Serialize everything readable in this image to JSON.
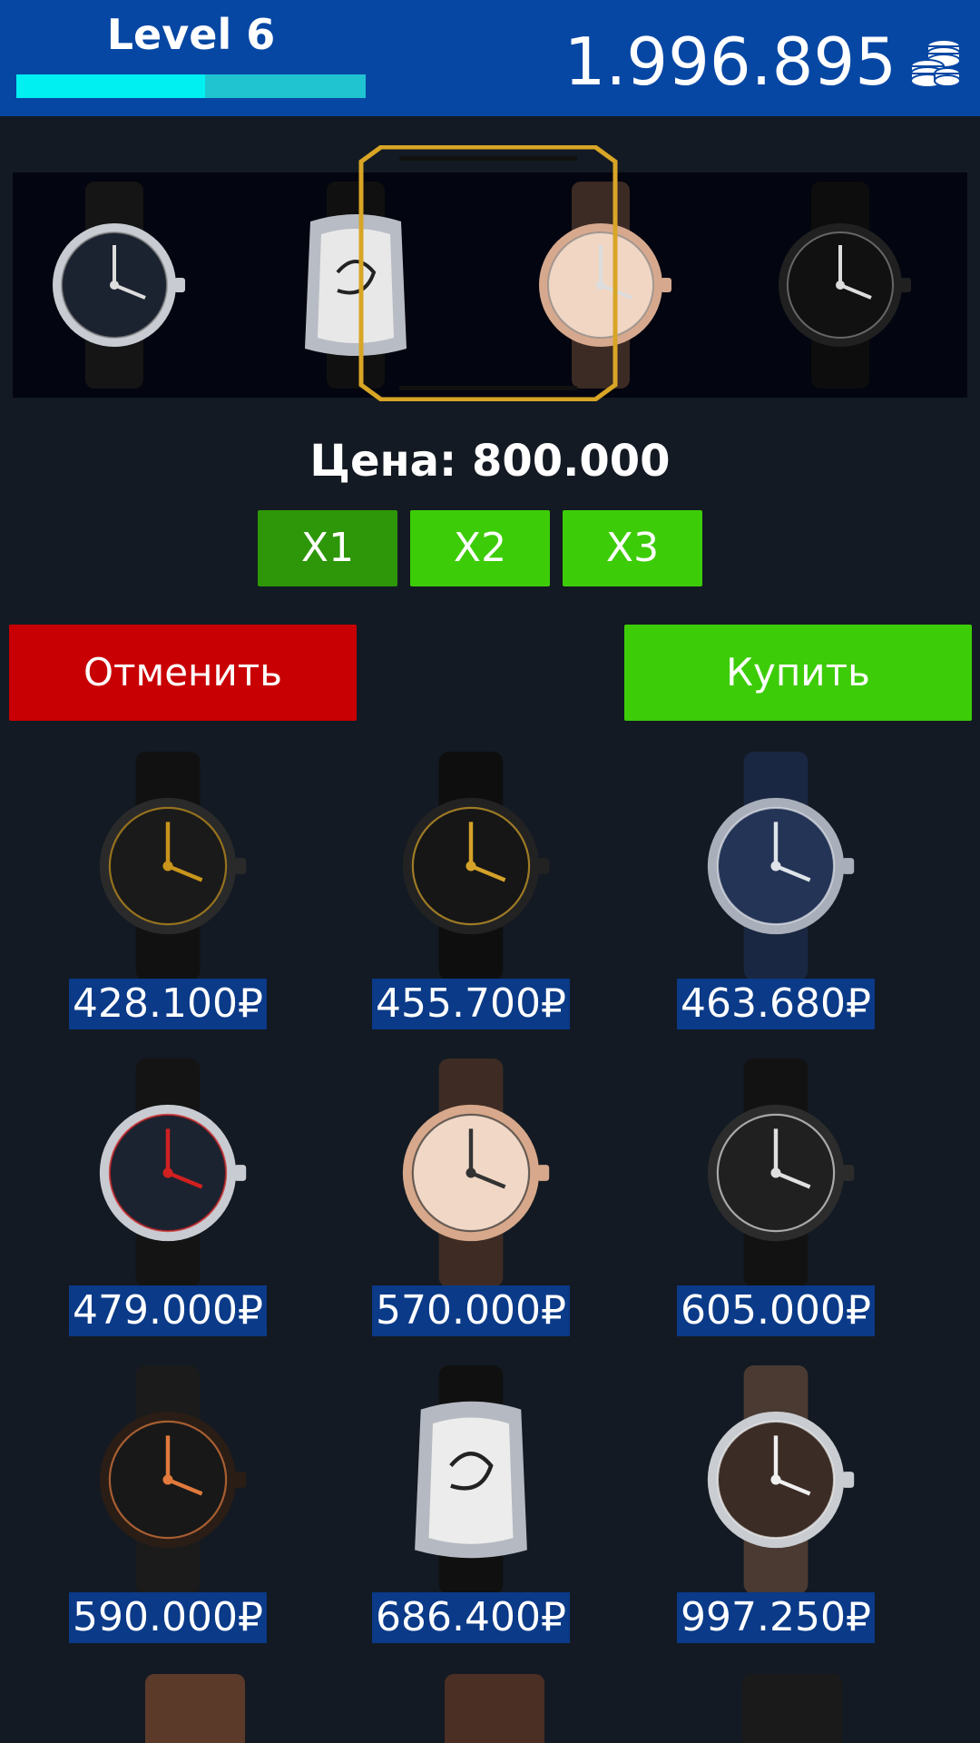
{
  "header": {
    "level_label": "Level 6",
    "xp_progress": 0.54,
    "coins": "1.996.895",
    "coins_icon": "coin-stack-icon"
  },
  "carousel": {
    "items": [
      {
        "name": "dark-dial-leather-watch",
        "dial": "#1c2330",
        "case": "#c8ccd2",
        "strap": "#151515"
      },
      {
        "name": "white-dial-diamond-tonneau-watch",
        "dial": "#e8e8e8",
        "case": "#b8bcc4",
        "strap": "#101010"
      },
      {
        "name": "champagne-dial-leather-watch",
        "dial": "#f1d6c4",
        "case": "#d6a98e",
        "strap": "#3b2b24"
      },
      {
        "name": "black-gold-turbine-watch",
        "dial": "#111111",
        "case": "#202020",
        "strap": "#0d0d0d"
      }
    ],
    "selected_index": 2
  },
  "price_line": "Цена: 800.000",
  "multipliers": [
    "X1",
    "X2",
    "X3"
  ],
  "active_multiplier": 0,
  "actions": {
    "cancel": "Отменить",
    "buy": "Купить"
  },
  "shop": {
    "items": [
      {
        "price": "428.100₽",
        "dial": "#1a1a1a",
        "case": "#2a2a2a",
        "strap": "#111111",
        "accent": "#c8941c"
      },
      {
        "price": "455.700₽",
        "dial": "#161616",
        "case": "#222222",
        "strap": "#0e0e0e",
        "accent": "#d4a22a"
      },
      {
        "price": "463.680₽",
        "dial": "#233456",
        "case": "#a8afba",
        "strap": "#1a2742",
        "accent": "#dfe3ea"
      },
      {
        "price": "479.000₽",
        "dial": "#1c2330",
        "case": "#c8ccd2",
        "strap": "#141414",
        "accent": "#d02020"
      },
      {
        "price": "570.000₽",
        "dial": "#f1d8c6",
        "case": "#d7a88b",
        "strap": "#3e2c24",
        "accent": "#333333"
      },
      {
        "price": "605.000₽",
        "dial": "#202020",
        "case": "#2c2c2c",
        "strap": "#121212",
        "accent": "#e0e0e0"
      },
      {
        "price": "590.000₽",
        "dial": "#181818",
        "case": "#2a1d16",
        "strap": "#1b1b1b",
        "accent": "#e07a3c"
      },
      {
        "price": "686.400₽",
        "dial": "#ececec",
        "case": "#b5b9c1",
        "strap": "#101010",
        "accent": "#c02020"
      },
      {
        "price": "997.250₽",
        "dial": "#3b2c26",
        "case": "#c9ccd0",
        "strap": "#4a3a32",
        "accent": "#f0f0f0"
      }
    ]
  },
  "peek_straps": [
    "#5b3a2a",
    "#4b2e24",
    "#1a1a1a"
  ]
}
